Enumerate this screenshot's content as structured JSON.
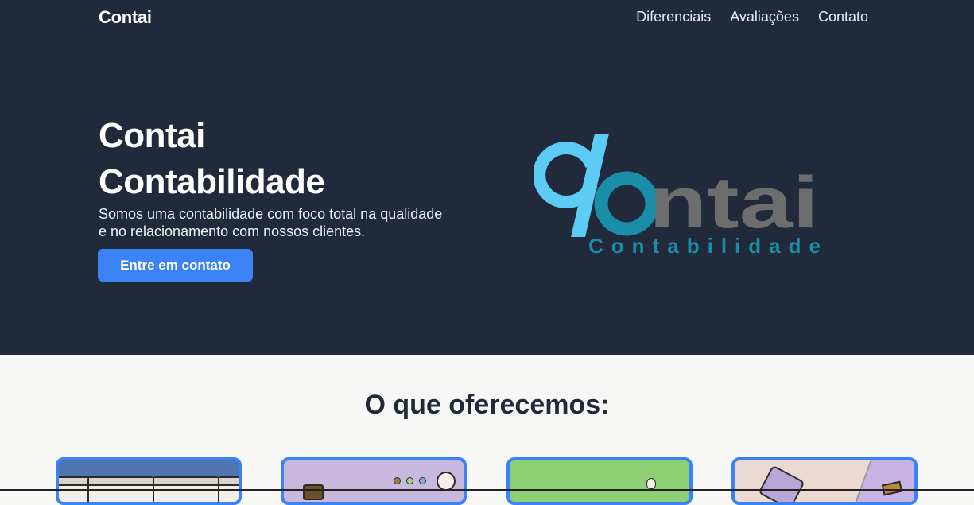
{
  "navbar": {
    "brand": "Contai",
    "links": [
      "Diferenciais",
      "Avaliações",
      "Contato"
    ]
  },
  "hero": {
    "title_line1": "Contai",
    "title_line2": "Contabilidade",
    "subtitle": "Somos uma contabilidade com foco total na qualidade e no relacionamento com nossos clientes.",
    "cta_label": "Entre em contato",
    "logo": {
      "wordmark": "Contai",
      "tagline": "Contabilidade"
    }
  },
  "offers": {
    "title": "O que oferecemos:",
    "cards": [
      {
        "name": "offer-card-1",
        "color": "#4f75b0"
      },
      {
        "name": "offer-card-2",
        "color": "#c9b8de"
      },
      {
        "name": "offer-card-3",
        "color": "#8dcf73"
      },
      {
        "name": "offer-card-4",
        "color": "#ecd9d2"
      }
    ]
  },
  "colors": {
    "hero_bg": "#202a3a",
    "accent": "#3b82f6",
    "logo_cyan": "#5ccbf5",
    "logo_gray": "#6d6d6d",
    "logo_teal": "#1a8ea8"
  }
}
